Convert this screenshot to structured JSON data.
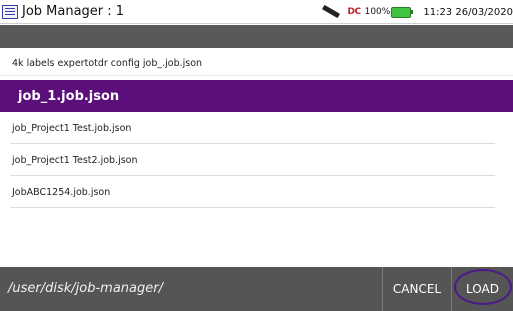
{
  "window": {
    "title": "Job Manager : 1",
    "menu_icon": "menu-list-icon"
  },
  "status": {
    "usb_icon": "usb-stick-icon",
    "dc_label": "DC",
    "battery_percent": "100%",
    "battery_icon": "battery-charging-icon",
    "time": "11:23",
    "date": "26/03/2020"
  },
  "file_list": {
    "current_file": "4k labels expertotdr config job_.job.json",
    "selected_file": "job_1.job.json",
    "files": [
      {
        "name": "job_Project1 Test.job.json"
      },
      {
        "name": "job_Project1 Test2.job.json"
      },
      {
        "name": "JobABC1254.job.json"
      }
    ]
  },
  "footer": {
    "path": "/user/disk/job-manager/",
    "cancel_label": "CANCEL",
    "load_label": "LOAD"
  },
  "colors": {
    "selection": "#5b0f7a",
    "bars": "#555555",
    "highlight_ring": "#4a1a8a"
  }
}
